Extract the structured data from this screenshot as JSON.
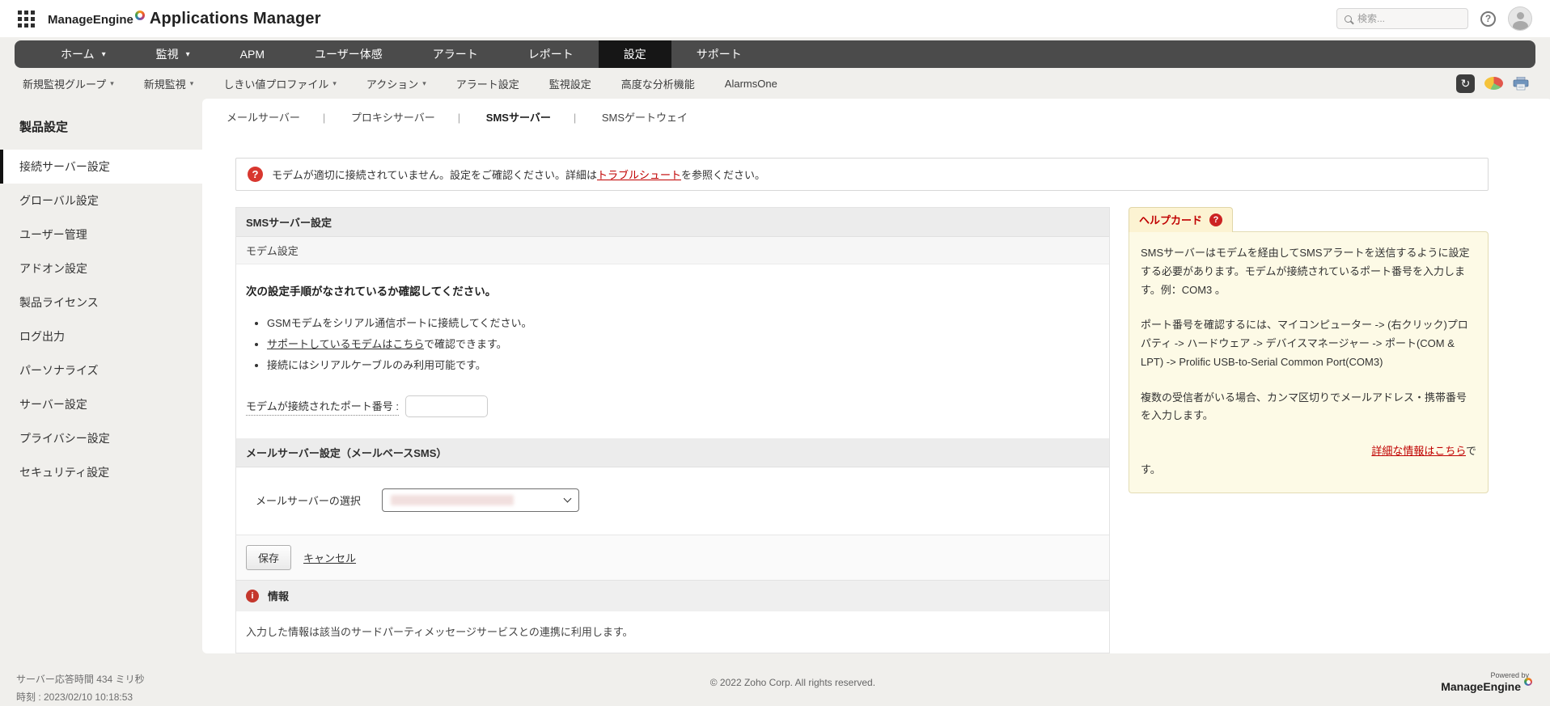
{
  "colors": {
    "page_bg": "#f0efec",
    "navbar_bg": "#4b4b4b",
    "navbar_active_bg": "#161616",
    "accent_red": "#c00000",
    "alert_icon_red": "#d8372f",
    "help_card_bg": "#fdfae6",
    "help_card_border": "#e3dcb4",
    "help_tab_bg": "#fcf3d2"
  },
  "header": {
    "brand": "ManageEngine",
    "product": "Applications Manager",
    "search_placeholder": "検索..."
  },
  "nav": {
    "items": [
      {
        "label": "ホーム",
        "caret": true
      },
      {
        "label": "監視",
        "caret": true
      },
      {
        "label": "APM"
      },
      {
        "label": "ユーザー体感"
      },
      {
        "label": "アラート"
      },
      {
        "label": "レポート"
      },
      {
        "label": "設定",
        "active": true
      },
      {
        "label": "サポート"
      }
    ]
  },
  "subnav": {
    "items": [
      {
        "label": "新規監視グループ",
        "caret": true
      },
      {
        "label": "新規監視",
        "caret": true
      },
      {
        "label": "しきい値プロファイル",
        "caret": true
      },
      {
        "label": "アクション",
        "caret": true
      },
      {
        "label": "アラート設定"
      },
      {
        "label": "監視設定"
      },
      {
        "label": "高度な分析機能"
      },
      {
        "label": "AlarmsOne"
      }
    ]
  },
  "sidebar": {
    "title": "製品設定",
    "items": [
      {
        "label": "接続サーバー設定",
        "active": true
      },
      {
        "label": "グローバル設定"
      },
      {
        "label": "ユーザー管理"
      },
      {
        "label": "アドオン設定"
      },
      {
        "label": "製品ライセンス"
      },
      {
        "label": "ログ出力"
      },
      {
        "label": "パーソナライズ"
      },
      {
        "label": "サーバー設定"
      },
      {
        "label": "プライバシー設定"
      },
      {
        "label": "セキュリティ設定"
      }
    ]
  },
  "tabs": {
    "items": [
      {
        "label": "メールサーバー"
      },
      {
        "label": "プロキシサーバー"
      },
      {
        "label": "SMSサーバー",
        "active": true
      },
      {
        "label": "SMSゲートウェイ"
      }
    ]
  },
  "alert": {
    "text_before": "モデムが適切に接続されていません。設定をご確認ください。詳細は",
    "link_label": "トラブルシュート",
    "text_after": "を参照ください。"
  },
  "form": {
    "title": "SMSサーバー設定",
    "modem_section_title": "モデム設定",
    "instruction": "次の設定手順がなされているか確認してください。",
    "bullet_1": "GSMモデムをシリアル通信ポートに接続してください。",
    "bullet_2_link": "サポートしているモデムはこちら",
    "bullet_2_suffix": "で確認できます。",
    "bullet_3": "接続にはシリアルケーブルのみ利用可能です。",
    "port_label": "モデムが接続されたポート番号 :",
    "port_value": "",
    "mail_section_title": "メールサーバー設定（メールベースSMS）",
    "mail_select_label": "メールサーバーの選択",
    "mail_select_value": "",
    "save_label": "保存",
    "cancel_label": "キャンセル",
    "info_title": "情報",
    "info_text": "入力した情報は該当のサードパーティメッセージサービスとの連携に利用します。"
  },
  "helpcard": {
    "title": "ヘルプカード",
    "paragraph_1": "SMSサーバーはモデムを経由してSMSアラートを送信するように設定する必要があります。モデムが接続されているポート番号を入力します。例：COM3 。",
    "paragraph_2": "ポート番号を確認するには、マイコンピューター -> (右クリック)プロパティ -> ハードウェア -> デバイスマネージャー -> ポート(COM & LPT) -> Prolific USB-to-Serial Common Port(COM3)",
    "paragraph_3": "複数の受信者がいる場合、カンマ区切りでメールアドレス・携帯番号を入力します。",
    "more_link_label": "詳細な情報はこちら",
    "more_link_tail": "で",
    "more_tail": "す。"
  },
  "footer": {
    "response_time": "サーバー応答時間 434 ミリ秒",
    "timestamp": "時刻 : 2023/02/10 10:18:53",
    "copyright": "© 2022 Zoho Corp.  All rights reserved.",
    "powered_by": "Powered by",
    "powered_brand": "ManageEngine"
  },
  "icons": {
    "caret": "▾",
    "refresh": "↻",
    "search": "magnifier",
    "question": "?",
    "info": "i"
  }
}
